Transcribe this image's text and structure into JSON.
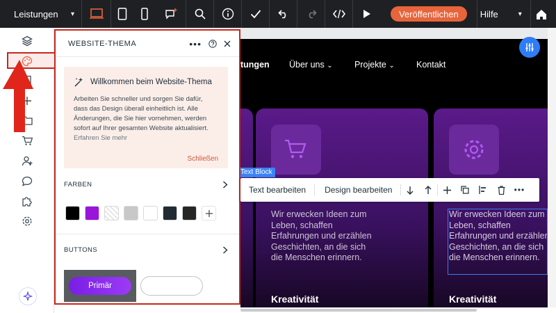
{
  "topbar": {
    "page_select": "Leistungen",
    "publish_label": "Veröffentlichen",
    "help_label": "Hilfe",
    "accent": "#e8643a"
  },
  "rail": {
    "icons": [
      "layers-icon",
      "palette-icon",
      "pages-icon",
      "add-icon",
      "folder-icon",
      "cart-icon",
      "members-icon",
      "chat-icon",
      "puzzle-icon",
      "settings-icon"
    ],
    "active": "palette-icon"
  },
  "panel": {
    "title": "WEBSITE-THEMA",
    "welcome_title": "Willkommen beim Website-Thema",
    "welcome_text": "Arbeiten Sie schneller und sorgen Sie dafür, dass das Design überall einheitlich ist. Alle Änderungen, die Sie hier vornehmen, werden sofort auf Ihrer gesamten Website aktualisiert.",
    "welcome_link": "Erfahren Sie mehr",
    "close_label": "Schließen",
    "colors_label": "FARBEN",
    "swatches": [
      "#000000",
      "#9b14dc",
      "#ffffff",
      "#c8c8c8",
      "#ffffff",
      "#212b33",
      "#262626"
    ],
    "buttons_label": "BUTTONS",
    "primary_button": "Primär"
  },
  "site": {
    "nav": [
      "tungen",
      "Über uns",
      "Projekte",
      "Kontakt"
    ],
    "card_text": "Wir erwecken Ideen zum Leben, schaffen Erfahrungen und erzählen Geschichten, an die sich die Menschen erinnern.",
    "card_heading": "Kreativität",
    "text_block_tag": "Text Block",
    "toolbar": {
      "edit_text": "Text bearbeiten",
      "edit_design": "Design bearbeiten"
    }
  }
}
